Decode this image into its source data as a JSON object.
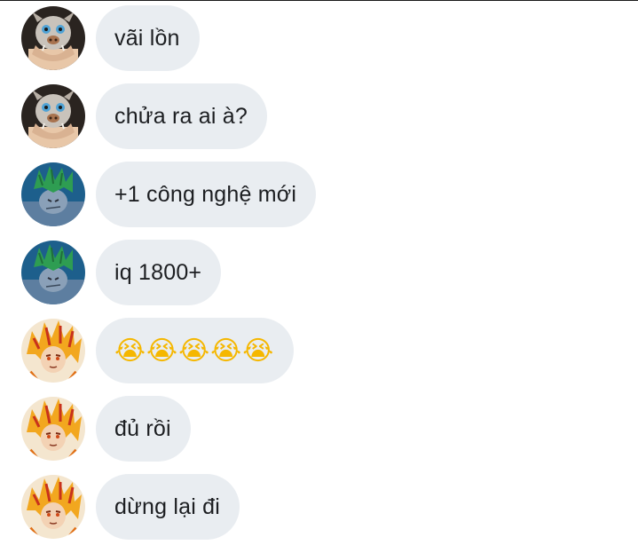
{
  "messages": [
    {
      "sender": "inosuke",
      "text": "vãi lồn"
    },
    {
      "sender": "inosuke",
      "text": "chửa ra ai à?"
    },
    {
      "sender": "sanemi",
      "text": "+1 công nghệ mới"
    },
    {
      "sender": "sanemi",
      "text": "iq 1800+"
    },
    {
      "sender": "rengoku",
      "text": "😭😭😭😭😭"
    },
    {
      "sender": "rengoku",
      "text": "đủ rồi"
    },
    {
      "sender": "rengoku",
      "text": "dừng lại đi"
    }
  ],
  "colors": {
    "bubble": "#e9edf1",
    "text": "#1c1e21",
    "page": "#ffffff"
  },
  "icons": {
    "inosuke": "boar-mask-avatar",
    "sanemi": "green-hair-avatar",
    "rengoku": "flame-hair-avatar"
  }
}
